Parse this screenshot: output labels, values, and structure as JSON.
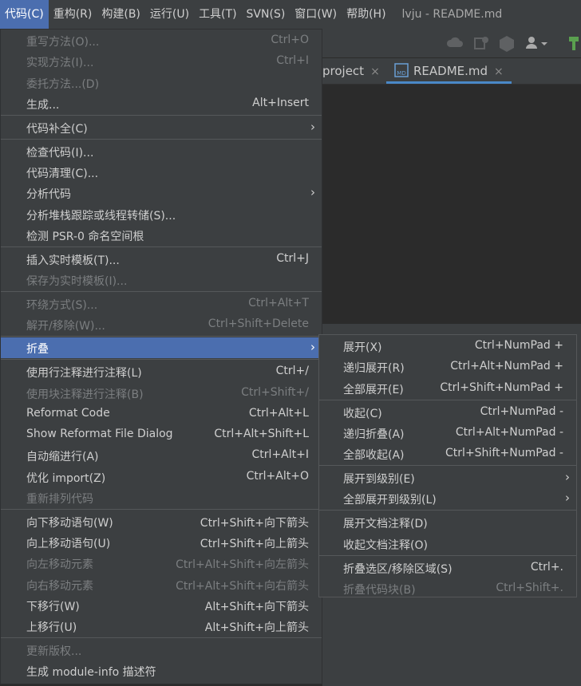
{
  "menubar": {
    "items": [
      "代码(C)",
      "重构(R)",
      "构建(B)",
      "运行(U)",
      "工具(T)",
      "SVN(S)",
      "窗口(W)",
      "帮助(H)"
    ],
    "title": "lvju - README.md"
  },
  "tabs": {
    "project": "project",
    "readme": "README.md",
    "close": "×",
    "md_badge": "MD"
  },
  "icons": [
    "cloud-icon",
    "svn-commit-icon",
    "hexagon-icon",
    "user-dropdown-icon",
    "build-hammer-icon"
  ],
  "menu": {
    "rewrite": {
      "label": "重写方法(O)...",
      "shortcut": "Ctrl+O"
    },
    "implement": {
      "label": "实现方法(I)...",
      "shortcut": "Ctrl+I"
    },
    "delegate": {
      "label": "委托方法...(D)"
    },
    "generate": {
      "label": "生成...",
      "shortcut": "Alt+Insert"
    },
    "completion": {
      "label": "代码补全(C)"
    },
    "inspect": {
      "label": "检查代码(I)..."
    },
    "cleanup": {
      "label": "代码清理(C)..."
    },
    "analyze": {
      "label": "分析代码"
    },
    "stacktrace": {
      "label": "分析堆栈跟踪或线程转储(S)..."
    },
    "psr0": {
      "label": "检测 PSR-0 命名空间根"
    },
    "live_template": {
      "label": "插入实时模板(T)...",
      "shortcut": "Ctrl+J"
    },
    "save_template": {
      "label": "保存为实时模板(I)..."
    },
    "surround": {
      "label": "环绕方式(S)...",
      "shortcut": "Ctrl+Alt+T"
    },
    "unwrap": {
      "label": "解开/移除(W)...",
      "shortcut": "Ctrl+Shift+Delete"
    },
    "fold": {
      "label": "折叠"
    },
    "line_comment": {
      "label": "使用行注释进行注释(L)",
      "shortcut": "Ctrl+/"
    },
    "block_comment": {
      "label": "使用块注释进行注释(B)",
      "shortcut": "Ctrl+Shift+/"
    },
    "reformat": {
      "label": "Reformat Code",
      "shortcut": "Ctrl+Alt+L"
    },
    "reformat_dialog": {
      "label": "Show Reformat File Dialog",
      "shortcut": "Ctrl+Alt+Shift+L"
    },
    "auto_indent": {
      "label": "自动缩进行(A)",
      "shortcut": "Ctrl+Alt+I"
    },
    "optimize_import": {
      "label": "优化 import(Z)",
      "shortcut": "Ctrl+Alt+O"
    },
    "rearrange": {
      "label": "重新排列代码"
    },
    "move_stmt_down": {
      "label": "向下移动语句(W)",
      "shortcut": "Ctrl+Shift+向下箭头"
    },
    "move_stmt_up": {
      "label": "向上移动语句(U)",
      "shortcut": "Ctrl+Shift+向上箭头"
    },
    "move_elem_left": {
      "label": "向左移动元素",
      "shortcut": "Ctrl+Alt+Shift+向左箭头"
    },
    "move_elem_right": {
      "label": "向右移动元素",
      "shortcut": "Ctrl+Alt+Shift+向右箭头"
    },
    "move_line_down": {
      "label": "下移行(W)",
      "shortcut": "Alt+Shift+向下箭头"
    },
    "move_line_up": {
      "label": "上移行(U)",
      "shortcut": "Alt+Shift+向上箭头"
    },
    "update_copyright": {
      "label": "更新版权..."
    },
    "module_info": {
      "label": "生成 module-info 描述符"
    }
  },
  "submenu": {
    "expand": {
      "label": "展开(X)",
      "shortcut": "Ctrl+NumPad +"
    },
    "expand_rec": {
      "label": "递归展开(R)",
      "shortcut": "Ctrl+Alt+NumPad +"
    },
    "expand_all": {
      "label": "全部展开(E)",
      "shortcut": "Ctrl+Shift+NumPad +"
    },
    "collapse": {
      "label": "收起(C)",
      "shortcut": "Ctrl+NumPad -"
    },
    "collapse_rec": {
      "label": "递归折叠(A)",
      "shortcut": "Ctrl+Alt+NumPad -"
    },
    "collapse_all": {
      "label": "全部收起(A)",
      "shortcut": "Ctrl+Shift+NumPad -"
    },
    "expand_level": {
      "label": "展开到级别(E)"
    },
    "expand_all_level": {
      "label": "全部展开到级别(L)"
    },
    "expand_doc": {
      "label": "展开文档注释(D)"
    },
    "collapse_doc": {
      "label": "收起文档注释(O)"
    },
    "fold_selection": {
      "label": "折叠选区/移除区域(S)",
      "shortcut": "Ctrl+."
    },
    "fold_block": {
      "label": "折叠代码块(B)",
      "shortcut": "Ctrl+Shift+."
    }
  },
  "arrow": "›",
  "colors": {
    "selection": "#4b6eaf",
    "menu_bg": "#3c3f41",
    "editor_bg": "#2b2b2b",
    "tab_underline": "#4a88c7"
  }
}
